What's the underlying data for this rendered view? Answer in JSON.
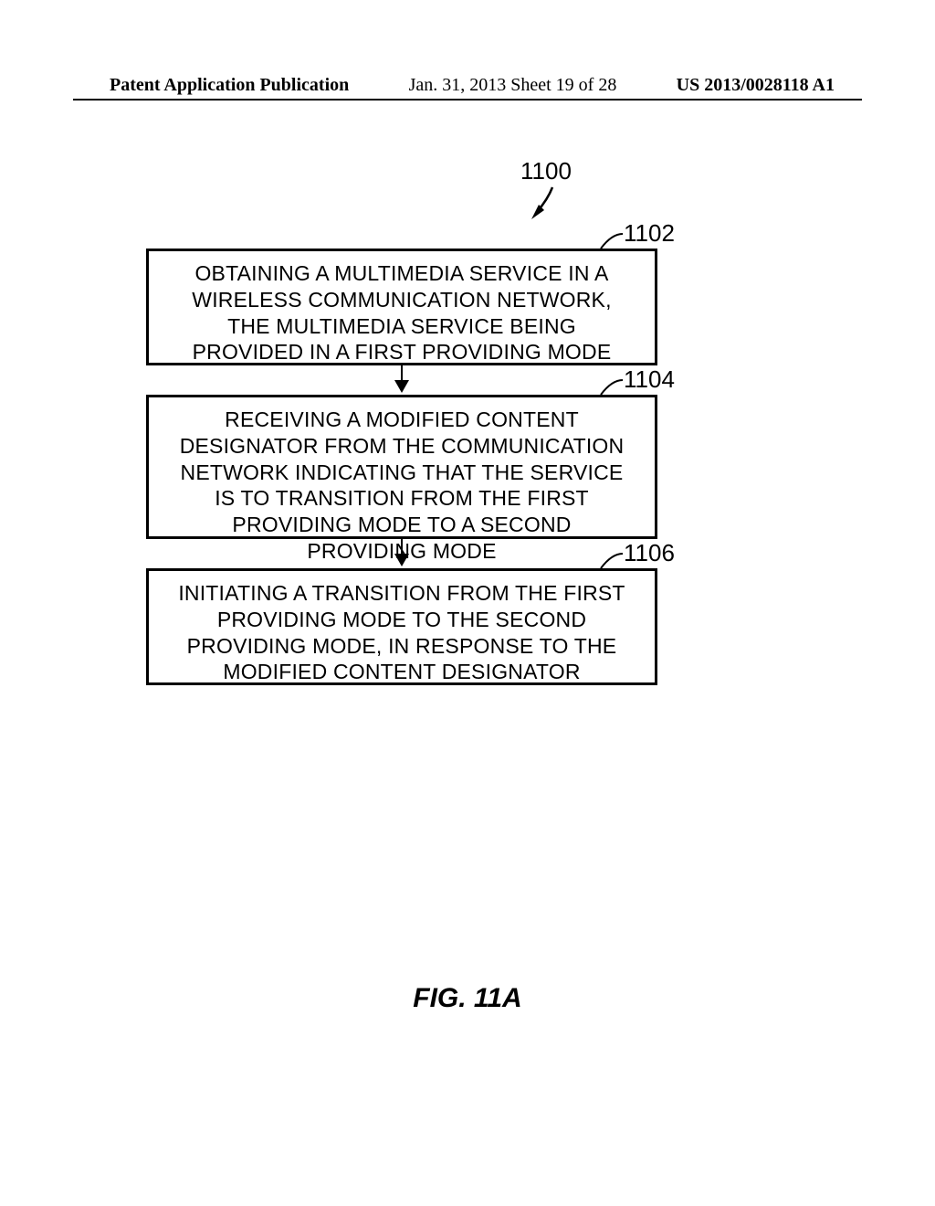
{
  "header": {
    "left": "Patent Application Publication",
    "mid": "Jan. 31, 2013  Sheet 19 of 28",
    "right": "US 2013/0028118 A1"
  },
  "refs": {
    "r1100": "1100",
    "r1102": "1102",
    "r1104": "1104",
    "r1106": "1106"
  },
  "boxes": {
    "b1": "OBTAINING A MULTIMEDIA SERVICE IN A WIRELESS COMMUNICATION NETWORK, THE MULTIMEDIA SERVICE BEING PROVIDED IN A FIRST PROVIDING MODE",
    "b2": "RECEIVING A MODIFIED CONTENT DESIGNATOR FROM THE COMMUNICATION NETWORK INDICATING THAT THE SERVICE IS TO TRANSITION FROM THE FIRST PROVIDING MODE TO A SECOND PROVIDING MODE",
    "b3": "INITIATING A TRANSITION FROM THE FIRST PROVIDING MODE TO THE SECOND PROVIDING MODE, IN RESPONSE TO THE MODIFIED CONTENT DESIGNATOR"
  },
  "caption": "FIG. 11A"
}
